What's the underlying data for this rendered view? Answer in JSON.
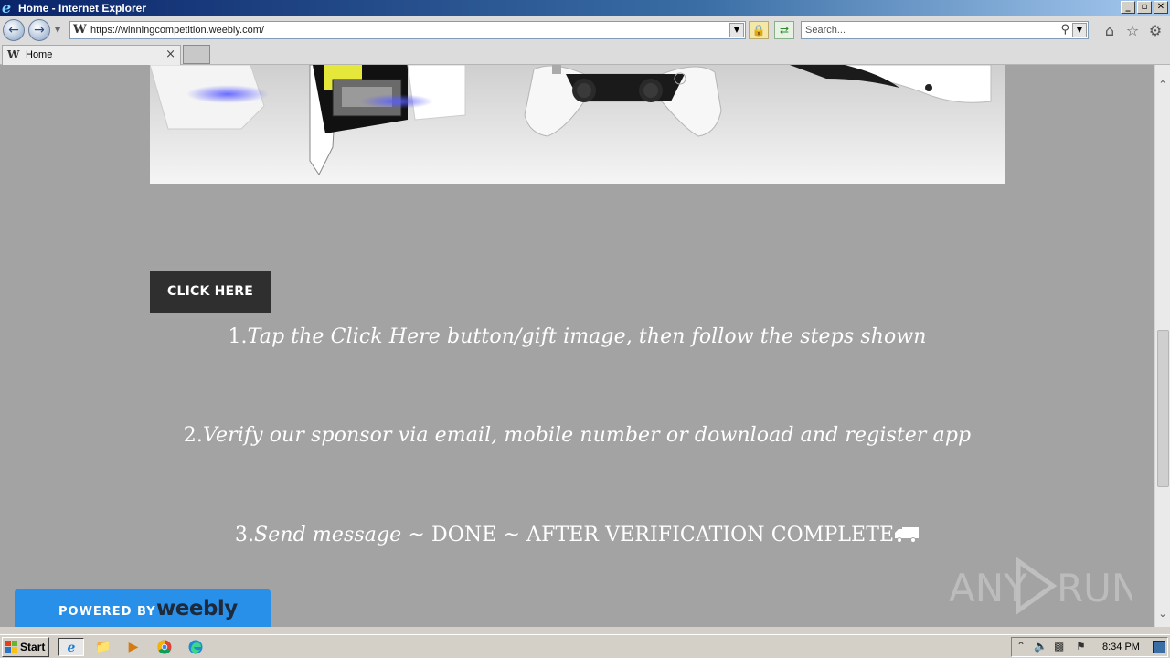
{
  "window": {
    "title": "Home - Internet Explorer",
    "controls": {
      "minimize": "_",
      "restore": "▫",
      "close": "✕"
    }
  },
  "navbar": {
    "back_icon": "back-arrow-icon",
    "forward_icon": "forward-arrow-icon",
    "url": "https://winningcompetition.weebly.com/",
    "search_placeholder": "Search...",
    "toolbar_icons": [
      "home-icon",
      "star-icon",
      "gear-icon"
    ]
  },
  "tabs": [
    {
      "label": "Home",
      "favicon": "W"
    }
  ],
  "page": {
    "cta_button": "CLICK HERE",
    "steps": [
      {
        "num": "1.",
        "text": "Tap the Click Here button/gift image, then follow the steps shown"
      },
      {
        "num": "2.",
        "text": "Verify our sponsor via email, mobile number or download and register app"
      },
      {
        "num": "3.",
        "italic": "Send message",
        "rest": " ~ DONE ~ AFTER VERIFICATION COMPLETE"
      }
    ],
    "powered_by": "POWERED BY",
    "brand": "weebly",
    "watermark": "ANY RUN"
  },
  "taskbar": {
    "start_label": "Start",
    "apps": [
      "internet-explorer-icon",
      "folder-icon",
      "media-player-icon",
      "chrome-icon",
      "edge-icon"
    ],
    "clock": "8:34 PM"
  },
  "colors": {
    "page_bg": "#a3a3a3",
    "button_bg": "#2f2f2f",
    "weebly_blue": "#2990ea",
    "title_bar": "#0a246a"
  }
}
